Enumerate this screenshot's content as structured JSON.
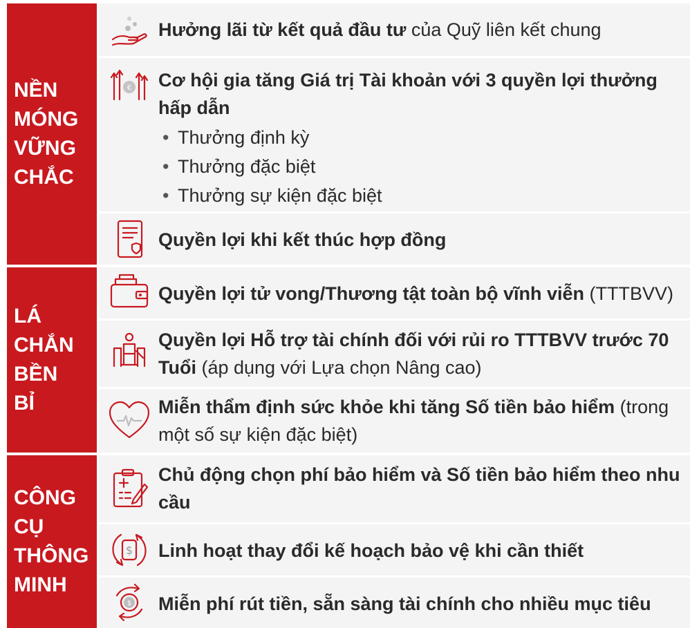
{
  "accent_color": "#c8191f",
  "row_background": "#f4f4f5",
  "groups": [
    {
      "title": "NỀN MÓNG VỮNG CHẮC",
      "rows": [
        {
          "icon": "hand-coins-icon",
          "bold": "Hưởng lãi từ kết quả đầu tư",
          "normal": " của Quỹ liên kết chung"
        },
        {
          "icon": "value-growth-icon",
          "bold": "Cơ hội gia tăng Giá trị Tài khoản với 3 quyền lợi thưởng hấp dẫn",
          "normal": "",
          "bullets": [
            "Thưởng định kỳ",
            "Thưởng đặc biệt",
            "Thưởng sự kiện đặc biệt"
          ]
        },
        {
          "icon": "contract-document-icon",
          "bold": "Quyền lợi khi kết thúc hợp đồng",
          "normal": ""
        }
      ]
    },
    {
      "title": "LÁ CHẮN BỀN BỈ",
      "rows": [
        {
          "icon": "wallet-icon",
          "bold": "Quyền lợi tử vong/Thương tật toàn bộ vĩnh viễn",
          "normal": " (TTTBVV)"
        },
        {
          "icon": "disabled-person-icon",
          "bold": "Quyền lợi Hỗ trợ tài chính đối với rủi ro TTTBVV trước 70 Tuổi",
          "normal": " (áp dụng với Lựa chọn Nâng cao)"
        },
        {
          "icon": "heart-pulse-icon",
          "bold": "Miễn thẩm định sức khỏe khi tăng Số tiền bảo hiểm",
          "normal": " (trong một số sự kiện đặc biệt)"
        }
      ]
    },
    {
      "title": "CÔNG CỤ THÔNG MINH",
      "rows": [
        {
          "icon": "clipboard-edit-icon",
          "bold": "Chủ động chọn phí bảo hiểm và Số tiền bảo hiểm theo nhu cầu",
          "normal": ""
        },
        {
          "icon": "dollar-cycle-icon",
          "bold": "Linh hoạt thay đổi kế hoạch bảo vệ khi cần thiết",
          "normal": ""
        },
        {
          "icon": "coin-exchange-icon",
          "bold": "Miễn phí rút tiền, sẵn sàng tài chính cho nhiều mục tiêu",
          "normal": ""
        }
      ]
    }
  ]
}
